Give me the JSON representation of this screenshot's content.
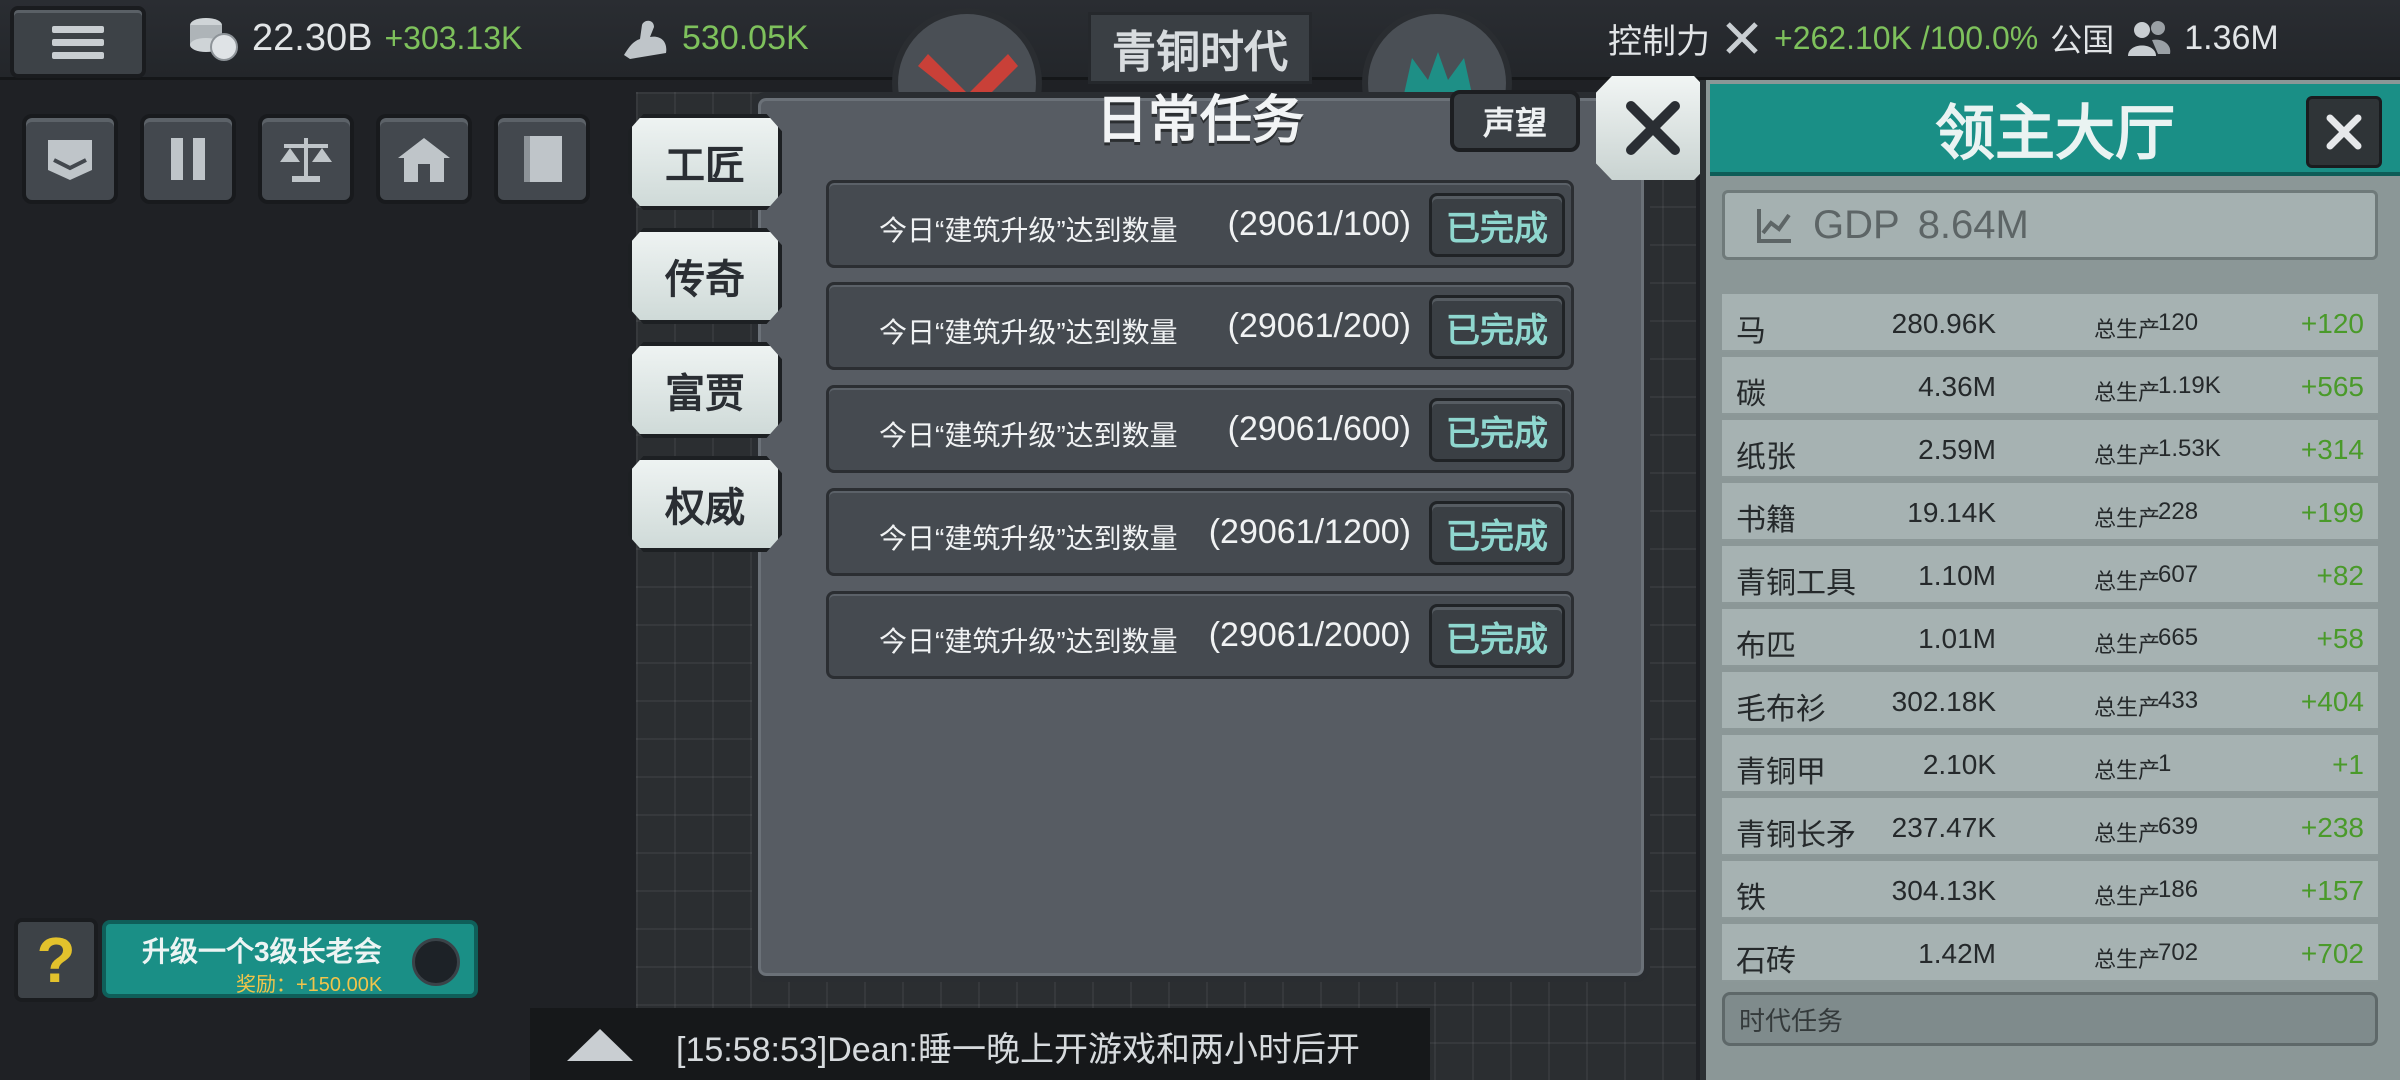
{
  "topbar": {
    "gold": "22.30B",
    "gold_rate": "+303.13K",
    "power": "530.05K",
    "era_title": "青铜时代",
    "control_label": "控制力",
    "control_value": "+262.10K /100.0%",
    "public_label": "公国",
    "population": "1.36M"
  },
  "categories": [
    "工匠",
    "传奇",
    "富贾",
    "权威"
  ],
  "modal": {
    "title": "日常任务",
    "fame_label": "声望",
    "tasks": [
      {
        "text": "今日“建筑升级”达到数量",
        "progress": "(29061/100)",
        "status": "已完成"
      },
      {
        "text": "今日“建筑升级”达到数量",
        "progress": "(29061/200)",
        "status": "已完成"
      },
      {
        "text": "今日“建筑升级”达到数量",
        "progress": "(29061/600)",
        "status": "已完成"
      },
      {
        "text": "今日“建筑升级”达到数量",
        "progress": "(29061/1200)",
        "status": "已完成"
      },
      {
        "text": "今日“建筑升级”达到数量",
        "progress": "(29061/2000)",
        "status": "已完成"
      }
    ]
  },
  "hall": {
    "title": "领主大厅",
    "gdp_label": "GDP",
    "gdp_value": "8.64M",
    "resources": [
      {
        "name": "马",
        "amount": "280.96K",
        "label": "总生产",
        "production": "120",
        "delta": "+120"
      },
      {
        "name": "碳",
        "amount": "4.36M",
        "label": "总生产",
        "production": "1.19K",
        "delta": "+565"
      },
      {
        "name": "纸张",
        "amount": "2.59M",
        "label": "总生产",
        "production": "1.53K",
        "delta": "+314"
      },
      {
        "name": "书籍",
        "amount": "19.14K",
        "label": "总生产",
        "production": "228",
        "delta": "+199"
      },
      {
        "name": "青铜工具",
        "amount": "1.10M",
        "label": "总生产",
        "production": "607",
        "delta": "+82"
      },
      {
        "name": "布匹",
        "amount": "1.01M",
        "label": "总生产",
        "production": "665",
        "delta": "+58"
      },
      {
        "name": "毛布衫",
        "amount": "302.18K",
        "label": "总生产",
        "production": "433",
        "delta": "+404"
      },
      {
        "name": "青铜甲",
        "amount": "2.10K",
        "label": "总生产",
        "production": "1",
        "delta": "+1"
      },
      {
        "name": "青铜长矛",
        "amount": "237.47K",
        "label": "总生产",
        "production": "639",
        "delta": "+238"
      },
      {
        "name": "铁",
        "amount": "304.13K",
        "label": "总生产",
        "production": "186",
        "delta": "+157"
      },
      {
        "name": "石砖",
        "amount": "1.42M",
        "label": "总生产",
        "production": "702",
        "delta": "+702"
      }
    ],
    "era_tasks_label": "时代任务"
  },
  "quest": {
    "title": "升级一个3级长老会",
    "reward": "奖励：+150.00K"
  },
  "chat": {
    "message": "[15:58:53]Dean:睡一晚上开游戏和两小时后开"
  },
  "colors": {
    "accent_teal": "#1a8f86",
    "positive_green": "#7ec15c",
    "done_text": "#8fd7cf",
    "gold_yellow": "#e3c22c"
  },
  "icons": {
    "menu": "hamburger-icon",
    "gold": "coins-icon",
    "power": "flexed-arm-icon",
    "control": "crossed-swords-icon",
    "population": "people-icon",
    "toolbar": [
      "banner-icon",
      "pause-icon",
      "balance-scale-icon",
      "house-icon",
      "book-icon"
    ]
  }
}
